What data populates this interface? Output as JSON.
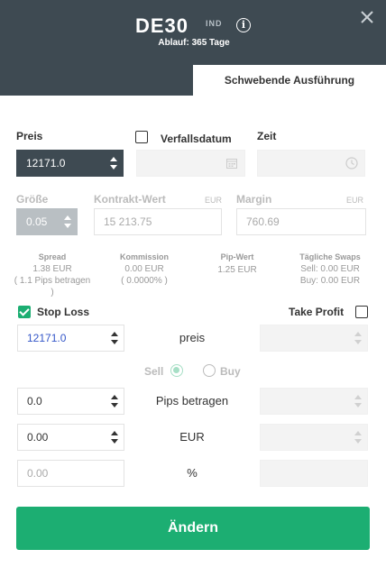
{
  "header": {
    "symbol": "DE30",
    "symbol_type": "IND",
    "expiry": "Ablauf: 365 Tage",
    "tab_active": "Schwebende Ausführung"
  },
  "order": {
    "price_label": "Preis",
    "price_value": "12171.0",
    "expiry_label": "Verfallsdatum",
    "expiry_checked": false,
    "time_label": "Zeit"
  },
  "size": {
    "size_label": "Größe",
    "size_value": "0.05",
    "contract_label": "Kontrakt-Wert",
    "contract_unit": "EUR",
    "contract_value": "15 213.75",
    "margin_label": "Margin",
    "margin_unit": "EUR",
    "margin_value": "760.69"
  },
  "stats": {
    "spread_label": "Spread",
    "spread_value": "1.38 EUR",
    "spread_pips_1": "( 1.1 Pips betragen",
    "spread_pips_2": ")",
    "commission_label": "Kommission",
    "commission_value": "0.00 EUR",
    "commission_pct": "( 0.0000% )",
    "pip_label": "Pip-Wert",
    "pip_value": "1.25 EUR",
    "swaps_label": "Tägliche Swaps",
    "swaps_sell": "Sell: 0.00 EUR",
    "swaps_buy": "Buy: 0.00 EUR"
  },
  "sl_tp": {
    "stop_loss_label": "Stop Loss",
    "stop_loss_checked": true,
    "take_profit_label": "Take Profit",
    "take_profit_checked": false,
    "sl_price": "12171.0",
    "row_price_label": "preis",
    "sell_label": "Sell",
    "buy_label": "Buy",
    "selected_side": "Sell",
    "sl_pips": "0.0",
    "row_pips_label": "Pips betragen",
    "sl_eur": "0.00",
    "row_eur_label": "EUR",
    "sl_pct": "0.00",
    "row_pct_label": "%"
  },
  "actions": {
    "submit_label": "Ändern"
  },
  "icons": {
    "info": "info-icon",
    "close": "close-icon",
    "calendar": "calendar-icon",
    "clock": "clock-icon"
  },
  "colors": {
    "header_bg": "#3e4a52",
    "accent": "#1cae72"
  }
}
